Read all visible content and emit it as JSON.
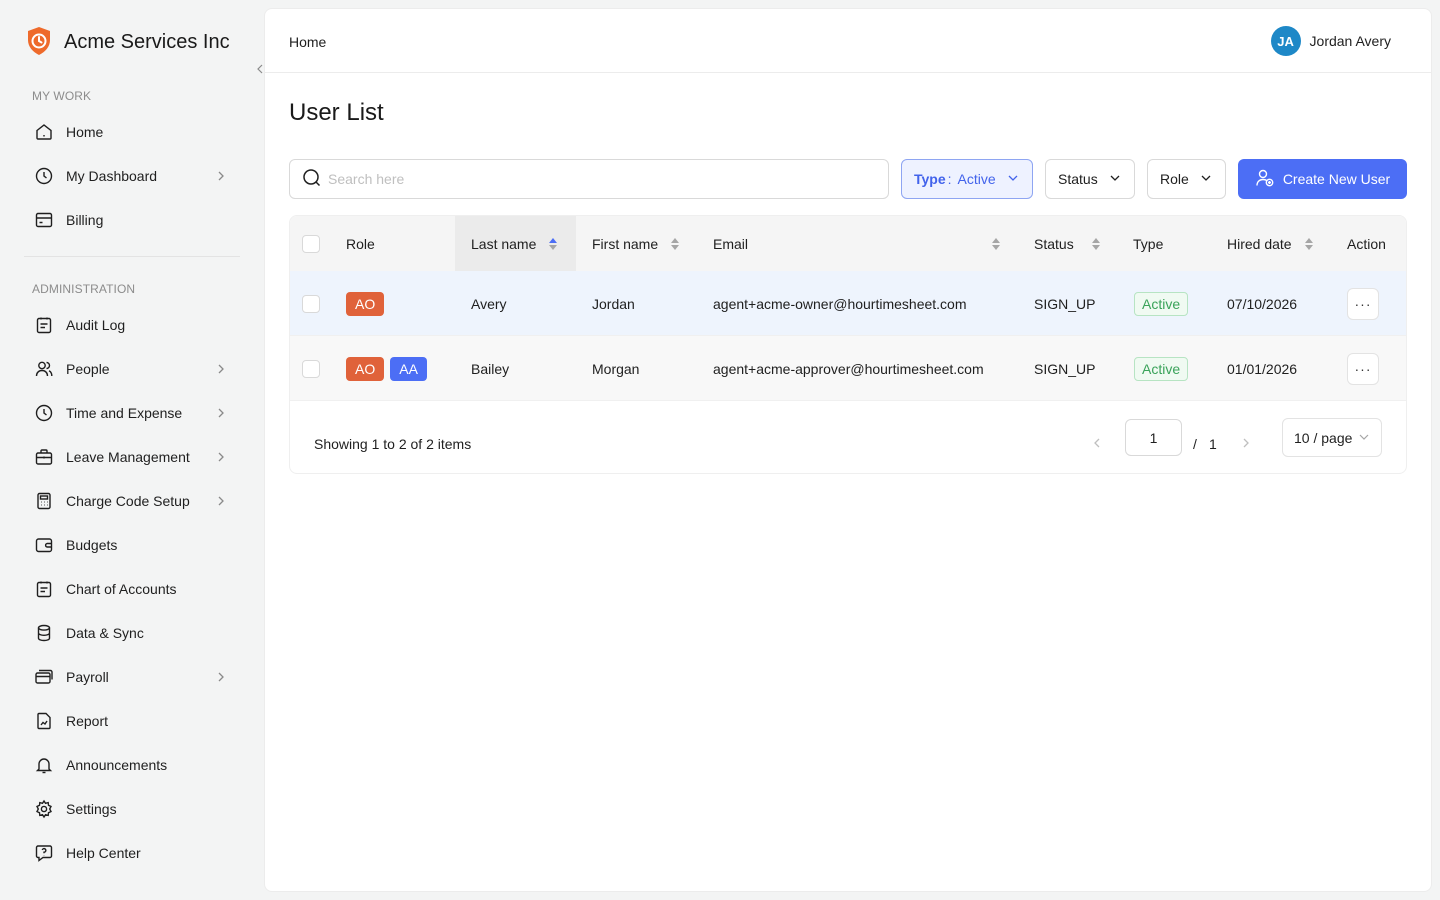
{
  "brand": {
    "name": "Acme Services Inc",
    "logo_icon": "shield-clock-icon",
    "accent": "#ee6a2b"
  },
  "sidebar": {
    "sections": [
      {
        "title": "MY WORK"
      },
      {
        "title": "ADMINISTRATION"
      }
    ],
    "items": [
      {
        "label": "Home",
        "icon": "home-icon",
        "has_children": false
      },
      {
        "label": "My Dashboard",
        "icon": "clock-icon",
        "has_children": true
      },
      {
        "label": "Billing",
        "icon": "billing-icon",
        "has_children": false
      },
      {
        "label": "Audit Log",
        "icon": "clipboard-icon",
        "has_children": false
      },
      {
        "label": "People",
        "icon": "people-icon",
        "has_children": true
      },
      {
        "label": "Time and Expense",
        "icon": "clock-icon",
        "has_children": true
      },
      {
        "label": "Leave Management",
        "icon": "briefcase-icon",
        "has_children": true
      },
      {
        "label": "Charge Code Setup",
        "icon": "calculator-icon",
        "has_children": true
      },
      {
        "label": "Budgets",
        "icon": "wallet-icon",
        "has_children": false
      },
      {
        "label": "Chart of Accounts",
        "icon": "clipboard-icon",
        "has_children": false
      },
      {
        "label": "Data & Sync",
        "icon": "database-icon",
        "has_children": false
      },
      {
        "label": "Payroll",
        "icon": "cards-icon",
        "has_children": true
      },
      {
        "label": "Report",
        "icon": "report-icon",
        "has_children": false
      },
      {
        "label": "Announcements",
        "icon": "bell-icon",
        "has_children": false
      },
      {
        "label": "Settings",
        "icon": "gear-icon",
        "has_children": false
      },
      {
        "label": "Help Center",
        "icon": "help-icon",
        "has_children": false
      }
    ]
  },
  "header": {
    "breadcrumb": "Home",
    "user": {
      "initials": "JA",
      "name": "Jordan Avery",
      "avatar_color": "#1e88c7"
    }
  },
  "main": {
    "title": "User List",
    "search": {
      "placeholder": "Search here",
      "value": ""
    },
    "filters": {
      "type": {
        "key": "Type",
        "separator": ":",
        "value": "Active"
      },
      "status": {
        "label": "Status"
      },
      "role": {
        "label": "Role"
      }
    },
    "create_button": {
      "label": "Create New User",
      "color": "#4c6ef5"
    },
    "table": {
      "columns": {
        "role": "Role",
        "last_name": "Last name",
        "first_name": "First name",
        "email": "Email",
        "status": "Status",
        "type": "Type",
        "hired_date": "Hired date",
        "action": "Action"
      },
      "sorted_column": "last_name",
      "sort_direction": "ascending",
      "rows": [
        {
          "roles": [
            "AO"
          ],
          "last_name": "Avery",
          "first_name": "Jordan",
          "email": "agent+acme-owner@hourtimesheet.com",
          "status": "SIGN_UP",
          "type": "Active",
          "hired_date": "07/10/2026",
          "action": "···"
        },
        {
          "roles": [
            "AO",
            "AA"
          ],
          "last_name": "Bailey",
          "first_name": "Morgan",
          "email": "agent+acme-approver@hourtimesheet.com",
          "status": "SIGN_UP",
          "type": "Active",
          "hired_date": "01/01/2026",
          "action": "···"
        }
      ],
      "role_colors": {
        "AO": "#e0623a",
        "AA": "#4c6ef5"
      }
    },
    "pagination": {
      "summary": "Showing 1 to 2 of 2 items",
      "current_page": "1",
      "separator": "/",
      "total_pages": "1",
      "page_size": "10 / page"
    }
  }
}
